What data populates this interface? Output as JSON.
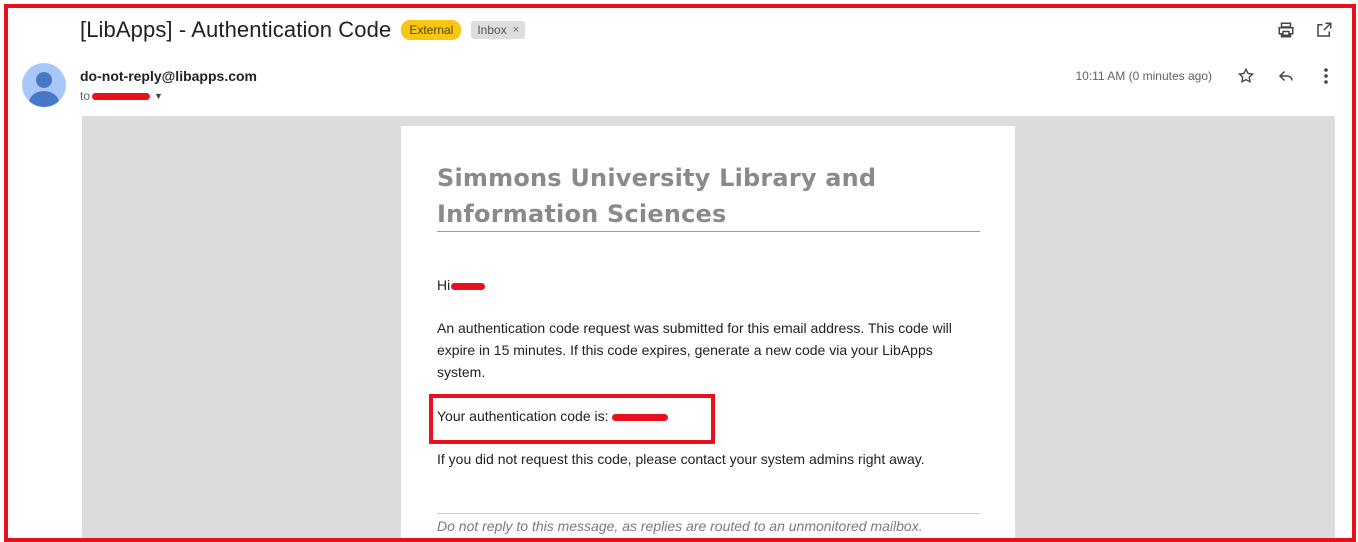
{
  "email": {
    "subject": "[LibApps] - Authentication Code",
    "labels": {
      "external": "External",
      "inbox": "Inbox",
      "inbox_remove": "×"
    },
    "sender": "do-not-reply@libapps.com",
    "to_prefix": "to",
    "time": "10:11 AM (0 minutes ago)",
    "icons": [
      "print-icon",
      "open-in-new-window-icon",
      "star-icon",
      "reply-icon",
      "more-vert-icon",
      "chevron-down-icon"
    ]
  },
  "message": {
    "org_title": "Simmons University Library and Information Sciences",
    "greeting": "Hi",
    "paragraph1": "An authentication code request was submitted for this email address. This code will expire in 15 minutes. If this code expires, generate a new code via your LibApps system.",
    "code_label": "Your authentication code is:",
    "paragraph2": "If you did not request this code, please contact your system admins right away.",
    "footer_note": "Do not reply to this message, as replies are routed to an unmonitored mailbox."
  },
  "colors": {
    "annotation_red": "#e8101c",
    "external_label": "#f8c613",
    "panel_gray": "#dcdcdc",
    "title_gray": "#8a8a8a"
  }
}
